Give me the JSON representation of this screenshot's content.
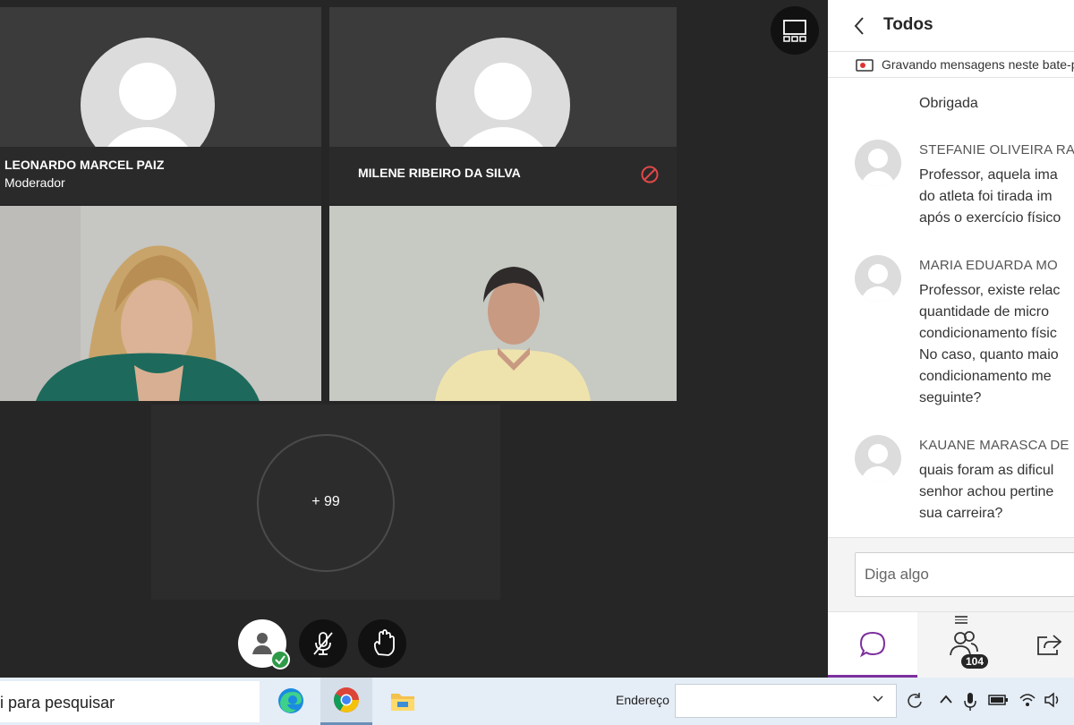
{
  "tiles": [
    {
      "name": "LEONARDO MARCEL PAIZ",
      "role": "Moderador"
    },
    {
      "name": "MILENE RIBEIRO DA SILVA"
    }
  ],
  "overflow_count": "+ 99",
  "chat": {
    "title": "Todos",
    "recording": "Gravando mensagens neste bate-papo",
    "messages": [
      {
        "lines": [
          "Obrigada"
        ]
      },
      {
        "author": "STEFANIE OLIVEIRA RA",
        "lines": [
          "Professor, aquela ima",
          "do atleta foi tirada im",
          "após o exercício físico"
        ]
      },
      {
        "author": "MARIA EDUARDA MO",
        "lines": [
          "Professor, existe relac",
          "quantidade de micro",
          "condicionamento físic",
          "No caso, quanto maio",
          "condicionamento me",
          "seguinte?"
        ]
      },
      {
        "author": "KAUANE MARASCA DE",
        "lines": [
          "quais foram as dificul",
          "senhor achou pertine",
          "sua carreira?"
        ]
      }
    ],
    "input_placeholder": "Diga algo",
    "participants_count": "104"
  },
  "taskbar": {
    "search_text": "i para pesquisar",
    "address_label": "Endereço"
  },
  "icons": [
    "layout-grid-icon",
    "mic-muted-icon",
    "raise-hand-icon",
    "chat-bubble-icon",
    "people-icon",
    "share-icon",
    "edge-icon",
    "chrome-icon",
    "file-explorer-icon"
  ],
  "colors": {
    "accent": "#7d2f9c",
    "status_ok": "#2e9a47",
    "ban": "#e04848"
  }
}
